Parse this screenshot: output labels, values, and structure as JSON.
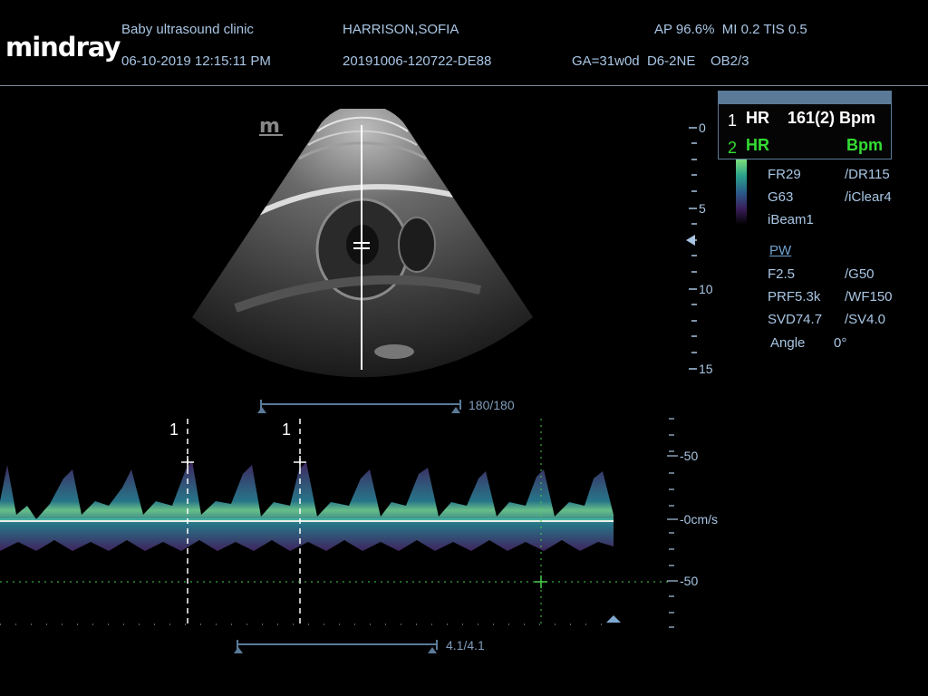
{
  "header": {
    "brand": "mindray",
    "clinic": "Baby ultrasound clinic",
    "datetime": "06-10-2019 12:15:11 PM",
    "patient_name": "HARRISON,SOFIA",
    "exam_id": "20191006-120722-DE88",
    "safety": "AP 96.6%  MI 0.2 TIS 0.5",
    "exam_info": "GA=31w0d  D6-2NE    OB2/3"
  },
  "hr_box": {
    "row1_index": "1",
    "row1_label": "HR",
    "row1_value": "161(2) Bpm",
    "row2_index": "2",
    "row2_label": "HR",
    "row2_value": "Bpm"
  },
  "bmode_params": [
    {
      "left": "FR29",
      "right": "/DR115"
    },
    {
      "left": "G63",
      "right": "/iClear4"
    },
    {
      "left": "iBeam1",
      "right": ""
    }
  ],
  "pw_mode": "PW",
  "pw_params": [
    {
      "left": "F2.5",
      "right": "/G50"
    },
    {
      "left": "PRF5.3k",
      "right": "/WF150"
    },
    {
      "left": "SVD74.7",
      "right": "/SV4.0"
    }
  ],
  "angle_label": "Angle",
  "angle_value": "0°",
  "depth_scale": [
    "0",
    "5",
    "10",
    "15"
  ],
  "cine_bmode": "180/180",
  "cine_doppler": "4.1/4.1",
  "velocity_scale": [
    "-50",
    "-0cm/s",
    "-50"
  ],
  "caliper_labels": [
    "1",
    "1"
  ],
  "colors": {
    "text": "#a9c6e4",
    "accent_green": "#33dd33",
    "scale_line": "#5a7a98"
  }
}
